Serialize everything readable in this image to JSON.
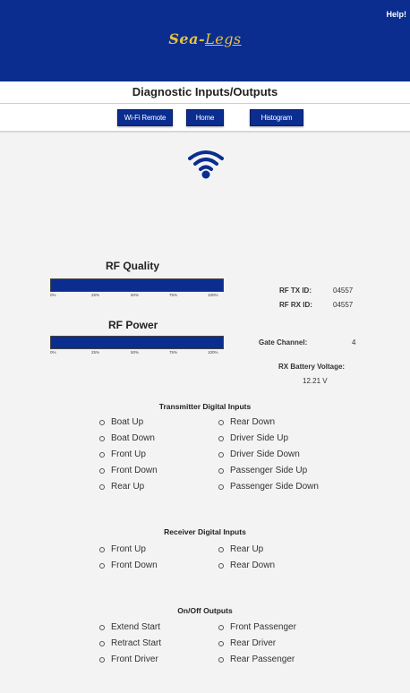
{
  "header": {
    "help_label": "Help!",
    "brand": "Sea-",
    "brand_script": "Legs",
    "brand_color": "#0a2d8f",
    "logo_color": "#e8c23a"
  },
  "page_title": "Diagnostic Inputs/Outputs",
  "nav": {
    "buttons": [
      "Wi-Fi Remote",
      "Home",
      "Histogram"
    ]
  },
  "status_icon": "wifi-icon",
  "rf_quality": {
    "label": "RF Quality",
    "value_percent": 100,
    "ticks": [
      "0%",
      "25%",
      "50%",
      "75%",
      "100%"
    ]
  },
  "rf_power": {
    "label": "RF Power",
    "value_percent": 100,
    "ticks": [
      "0%",
      "25%",
      "50%",
      "75%",
      "100%"
    ]
  },
  "info": {
    "rf_tx_id_label": "RF TX ID:",
    "rf_tx_id_value": "04557",
    "rf_rx_id_label": "RF RX ID:",
    "rf_rx_id_value": "04557",
    "gate_channel_label": "Gate Channel:",
    "gate_channel_value": "4",
    "rx_battery_label": "RX Battery Voltage:",
    "rx_battery_value": "12.21 V"
  },
  "transmitter_inputs": {
    "title": "Transmitter Digital Inputs",
    "left": [
      "Boat Up",
      "Boat Down",
      "Front Up",
      "Front Down",
      "Rear Up"
    ],
    "right": [
      "Rear Down",
      "Driver Side Up",
      "Driver Side Down",
      "Passenger Side Up",
      "Passenger Side Down"
    ]
  },
  "receiver_inputs": {
    "title": "Receiver Digital Inputs",
    "left": [
      "Front Up",
      "Front Down"
    ],
    "right": [
      "Rear Up",
      "Rear Down"
    ]
  },
  "outputs": {
    "title": "On/Off Outputs",
    "left": [
      "Extend Start",
      "Retract Start",
      "Front Driver"
    ],
    "right": [
      "Front Passenger",
      "Rear Driver",
      "Rear Passenger"
    ]
  }
}
